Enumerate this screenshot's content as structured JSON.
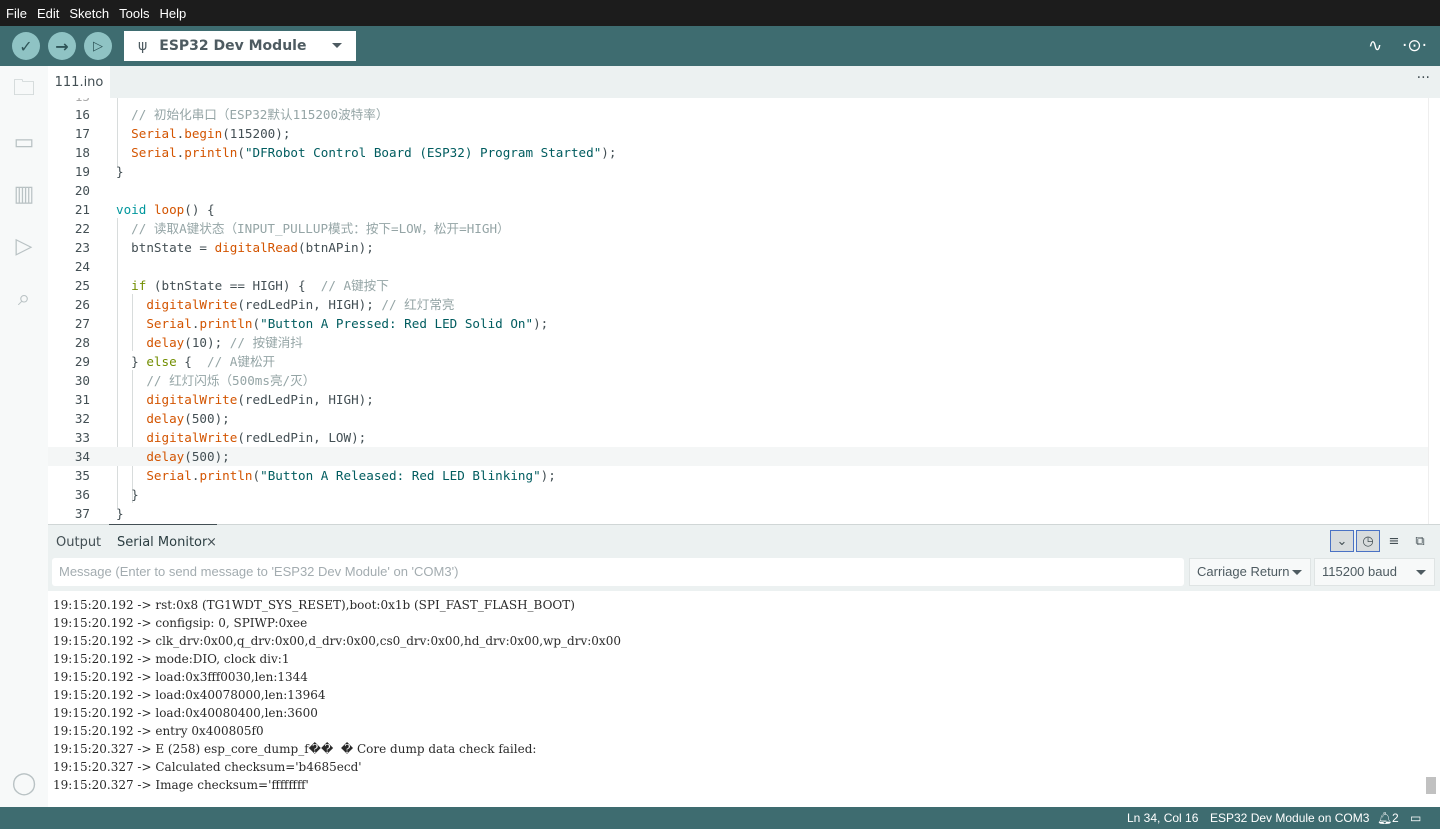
{
  "menu": [
    "File",
    "Edit",
    "Sketch",
    "Tools",
    "Help"
  ],
  "toolbar": {
    "board": "ESP32 Dev Module"
  },
  "tab": {
    "name": "111.ino",
    "more": "···"
  },
  "editor": {
    "current_line": "34",
    "lines": [
      {
        "n": "16",
        "t": [
          [
            "cm",
            "  // 初始化串口（ESP32默认115200波特率）"
          ]
        ]
      },
      {
        "n": "17",
        "t": [
          [
            "pl",
            "  "
          ],
          [
            "fn",
            "Serial"
          ],
          [
            "pl",
            "."
          ],
          [
            "fn",
            "begin"
          ],
          [
            "pl",
            "(115200);"
          ]
        ]
      },
      {
        "n": "18",
        "t": [
          [
            "pl",
            "  "
          ],
          [
            "fn",
            "Serial"
          ],
          [
            "pl",
            "."
          ],
          [
            "fn",
            "println"
          ],
          [
            "pl",
            "("
          ],
          [
            "st",
            "\"DFRobot Control Board (ESP32) Program Started\""
          ],
          [
            "pl",
            ");"
          ]
        ]
      },
      {
        "n": "19",
        "t": [
          [
            "pl",
            "}"
          ]
        ]
      },
      {
        "n": "20",
        "t": []
      },
      {
        "n": "21",
        "t": [
          [
            "kw",
            "void"
          ],
          [
            "pl",
            " "
          ],
          [
            "fn",
            "loop"
          ],
          [
            "pl",
            "() {"
          ]
        ]
      },
      {
        "n": "22",
        "t": [
          [
            "cm",
            "  // 读取A键状态（INPUT_PULLUP模式：按下=LOW，松开=HIGH）"
          ]
        ]
      },
      {
        "n": "23",
        "t": [
          [
            "pl",
            "  btnState = "
          ],
          [
            "fn",
            "digitalRead"
          ],
          [
            "pl",
            "(btnAPin);"
          ]
        ]
      },
      {
        "n": "24",
        "t": []
      },
      {
        "n": "25",
        "t": [
          [
            "pl",
            "  "
          ],
          [
            "kw2",
            "if"
          ],
          [
            "pl",
            " (btnState == HIGH) {  "
          ],
          [
            "cm",
            "// A键按下"
          ]
        ]
      },
      {
        "n": "26",
        "t": [
          [
            "pl",
            "    "
          ],
          [
            "fn",
            "digitalWrite"
          ],
          [
            "pl",
            "(redLedPin, HIGH); "
          ],
          [
            "cm",
            "// 红灯常亮"
          ]
        ]
      },
      {
        "n": "27",
        "t": [
          [
            "pl",
            "    "
          ],
          [
            "fn",
            "Serial"
          ],
          [
            "pl",
            "."
          ],
          [
            "fn",
            "println"
          ],
          [
            "pl",
            "("
          ],
          [
            "st",
            "\"Button A Pressed: Red LED Solid On\""
          ],
          [
            "pl",
            ");"
          ]
        ]
      },
      {
        "n": "28",
        "t": [
          [
            "pl",
            "    "
          ],
          [
            "fn",
            "delay"
          ],
          [
            "pl",
            "(10); "
          ],
          [
            "cm",
            "// 按键消抖"
          ]
        ]
      },
      {
        "n": "29",
        "t": [
          [
            "pl",
            "  } "
          ],
          [
            "kw2",
            "else"
          ],
          [
            "pl",
            " {  "
          ],
          [
            "cm",
            "// A键松开"
          ]
        ]
      },
      {
        "n": "30",
        "t": [
          [
            "cm",
            "    // 红灯闪烁（500ms亮/灭）"
          ]
        ]
      },
      {
        "n": "31",
        "t": [
          [
            "pl",
            "    "
          ],
          [
            "fn",
            "digitalWrite"
          ],
          [
            "pl",
            "(redLedPin, HIGH);"
          ]
        ]
      },
      {
        "n": "32",
        "t": [
          [
            "pl",
            "    "
          ],
          [
            "fn",
            "delay"
          ],
          [
            "pl",
            "(500);"
          ]
        ]
      },
      {
        "n": "33",
        "t": [
          [
            "pl",
            "    "
          ],
          [
            "fn",
            "digitalWrite"
          ],
          [
            "pl",
            "(redLedPin, LOW);"
          ]
        ]
      },
      {
        "n": "34",
        "t": [
          [
            "pl",
            "    "
          ],
          [
            "fn",
            "delay"
          ],
          [
            "pl",
            "(500);"
          ]
        ]
      },
      {
        "n": "35",
        "t": [
          [
            "pl",
            "    "
          ],
          [
            "fn",
            "Serial"
          ],
          [
            "pl",
            "."
          ],
          [
            "fn",
            "println"
          ],
          [
            "pl",
            "("
          ],
          [
            "st",
            "\"Button A Released: Red LED Blinking\""
          ],
          [
            "pl",
            ");"
          ]
        ]
      },
      {
        "n": "36",
        "t": [
          [
            "pl",
            "  }"
          ]
        ]
      },
      {
        "n": "37",
        "t": [
          [
            "pl",
            "}"
          ]
        ]
      }
    ]
  },
  "panel": {
    "tabs": [
      "Output",
      "Serial Monitor"
    ],
    "close": "×",
    "message_placeholder": "Message (Enter to send message to 'ESP32 Dev Module' on 'COM3')",
    "line_ending": "Carriage Return",
    "baud": "115200 baud",
    "output": [
      "19:15:20.192 -> rst:0x8 (TG1WDT_SYS_RESET),boot:0x1b (SPI_FAST_FLASH_BOOT)",
      "19:15:20.192 -> configsip: 0, SPIWP:0xee",
      "19:15:20.192 -> clk_drv:0x00,q_drv:0x00,d_drv:0x00,cs0_drv:0x00,hd_drv:0x00,wp_drv:0x00",
      "19:15:20.192 -> mode:DIO, clock div:1",
      "19:15:20.192 -> load:0x3fff0030,len:1344",
      "19:15:20.192 -> load:0x40078000,len:13964",
      "19:15:20.192 -> load:0x40080400,len:3600",
      "19:15:20.192 -> entry 0x400805f0",
      "19:15:20.327 -> E (258) esp_core_dump_f��  � Core dump data check failed:",
      "19:15:20.327 -> Calculated checksum='b4685ecd'",
      "19:15:20.327 -> Image checksum='ffffffff'"
    ]
  },
  "status": {
    "position": "Ln 34, Col 16",
    "board": "ESP32 Dev Module on COM3",
    "notifications": "2"
  }
}
